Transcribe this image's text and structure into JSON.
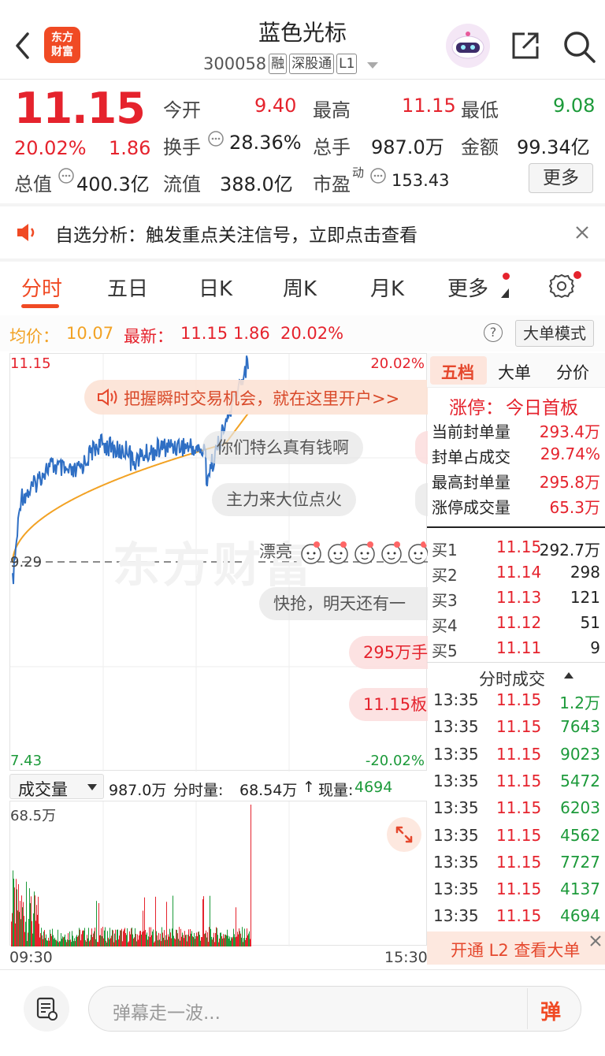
{
  "header": {
    "title": "蓝色光标",
    "code": "300058",
    "tags": [
      "融",
      "深股通",
      "L1"
    ],
    "logo_line1": "东方",
    "logo_line2": "财富"
  },
  "quote": {
    "price": "11.15",
    "pct": "20.02%",
    "change": "1.86",
    "open_label": "今开",
    "open": "9.40",
    "high_label": "最高",
    "high": "11.15",
    "low_label": "最低",
    "low": "9.08",
    "turnover_label": "换手",
    "turnover": "28.36%",
    "volume_label": "总手",
    "volume": "987.0万",
    "amount_label": "金额",
    "amount": "99.34亿",
    "mktcap_label": "总值",
    "mktcap": "400.3亿",
    "float_label": "流值",
    "float": "388.0亿",
    "pe_label": "市盈",
    "pe_sup": "动",
    "pe": "153.43",
    "more": "更多"
  },
  "notice": {
    "text": "自选分析：触发重点关注信号，立即点击查看"
  },
  "tabs": [
    "分时",
    "五日",
    "日K",
    "周K",
    "月K",
    "更多"
  ],
  "stripe": {
    "avg_label": "均价：",
    "avg": "10.07",
    "latest_label": "最新：",
    "latest": "11.15",
    "change": "1.86",
    "pct": "20.02%",
    "help": "?",
    "mode_btn": "大单模式"
  },
  "axis": {
    "top_left": "11.15",
    "top_right": "20.02%",
    "mid": "9.29",
    "bottom_left": "7.43",
    "bottom_right": "-20.02%",
    "vol_max": "68.5万",
    "time_start": "09:30",
    "time_end": "15:30"
  },
  "promo": "把握瞬时交易机会，就在这里开户>>",
  "danmaku": [
    "你们特么真有钱啊",
    "主力来大位点火",
    "漂亮",
    "快抢，明天还有一",
    "295万手",
    "11.15板"
  ],
  "watermark": "东方财富",
  "volbar": {
    "selector": "成交量",
    "total": "987.0万",
    "period_label": "分时量:",
    "period": "68.54万",
    "now_label": "现量:",
    "now": "4694"
  },
  "panel": {
    "tabs": [
      "五档",
      "大单",
      "分价"
    ],
    "limit_label": "涨停：",
    "limit_val": "今日首板",
    "stats": [
      {
        "label": "当前封单量",
        "value": "293.4万"
      },
      {
        "label": "封单占成交",
        "value": "29.74%"
      },
      {
        "label": "最高封单量",
        "value": "295.8万"
      },
      {
        "label": "涨停成交量",
        "value": "65.3万"
      }
    ],
    "bids": [
      {
        "label": "买1",
        "price": "11.15",
        "vol": "292.7万"
      },
      {
        "label": "买2",
        "price": "11.14",
        "vol": "298"
      },
      {
        "label": "买3",
        "price": "11.13",
        "vol": "121"
      },
      {
        "label": "买4",
        "price": "11.12",
        "vol": "51"
      },
      {
        "label": "买5",
        "price": "11.11",
        "vol": "9"
      }
    ],
    "trades_title": "分时成交",
    "trades": [
      {
        "t": "13:35",
        "p": "11.15",
        "v": "1.2万"
      },
      {
        "t": "13:35",
        "p": "11.15",
        "v": "7643"
      },
      {
        "t": "13:35",
        "p": "11.15",
        "v": "9023"
      },
      {
        "t": "13:35",
        "p": "11.15",
        "v": "5472"
      },
      {
        "t": "13:35",
        "p": "11.15",
        "v": "6203"
      },
      {
        "t": "13:35",
        "p": "11.15",
        "v": "4562"
      },
      {
        "t": "13:35",
        "p": "11.15",
        "v": "7727"
      },
      {
        "t": "13:35",
        "p": "11.15",
        "v": "4137"
      },
      {
        "t": "13:35",
        "p": "11.15",
        "v": "4694"
      }
    ],
    "l2": "开通 L2 查看大单"
  },
  "bottom": {
    "placeholder": "弹幕走一波...",
    "danmaku_btn": "弹"
  },
  "colors": {
    "up": "#e5232d",
    "down": "#1c9a3a",
    "avg": "#f2a224",
    "line": "#2f6fc4",
    "accent": "#f04a24"
  }
}
